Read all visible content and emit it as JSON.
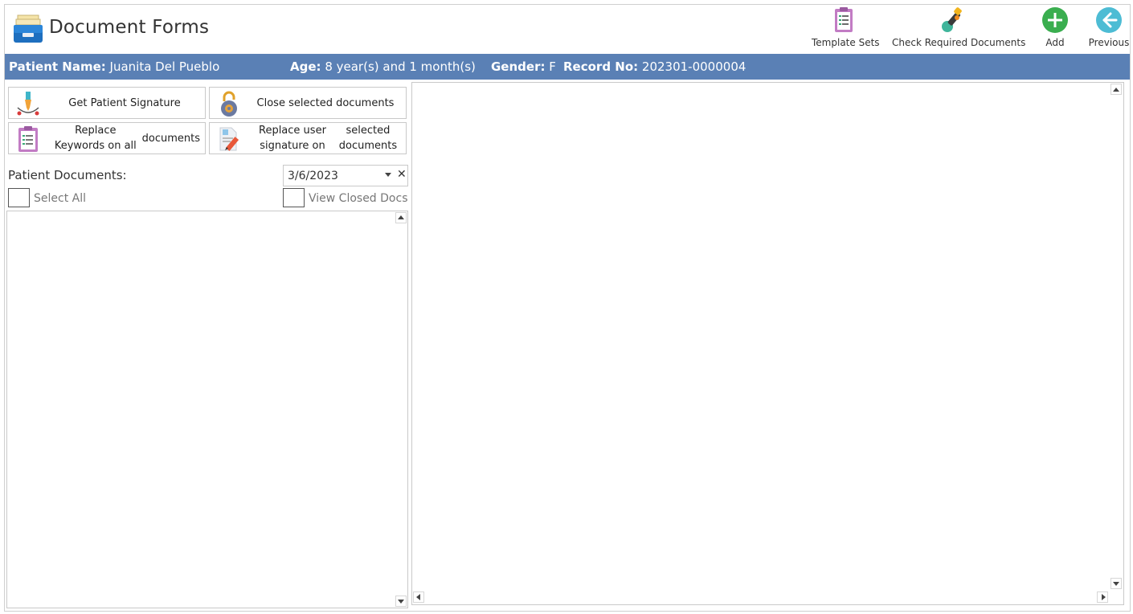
{
  "header": {
    "title": "Document Forms",
    "app_icon": "file-cabinet-icon"
  },
  "toolbar": {
    "template_sets": {
      "label": "Template Sets",
      "icon": "clipboard-icon"
    },
    "check_required": {
      "label": "Check Required Documents",
      "icon": "paint-brush-icon"
    },
    "add": {
      "label": "Add",
      "icon": "plus-circle-icon",
      "color": "#3aae4f"
    },
    "previous": {
      "label": "Previous",
      "icon": "arrow-left-circle-icon",
      "color": "#4dbcd4"
    }
  },
  "patient": {
    "name_label": "Patient Name:",
    "name": "Juanita Del Pueblo",
    "age_label": "Age:",
    "age": "8 year(s) and 1 month(s)",
    "gender_label": "Gender:",
    "gender": "F",
    "record_label": "Record No:",
    "record": "202301-0000004",
    "bar_color": "#5a80b5"
  },
  "actions": {
    "get_signature": "Get Patient Signature",
    "close_docs": "Close selected documents",
    "replace_keywords_1": "Replace Keywords on all",
    "replace_keywords_2": "documents",
    "replace_signature_1": "Replace user signature on",
    "replace_signature_2": "selected documents"
  },
  "documents": {
    "label": "Patient Documents:",
    "date": "3/6/2023",
    "select_all": "Select All",
    "view_closed": "View Closed Docs"
  }
}
